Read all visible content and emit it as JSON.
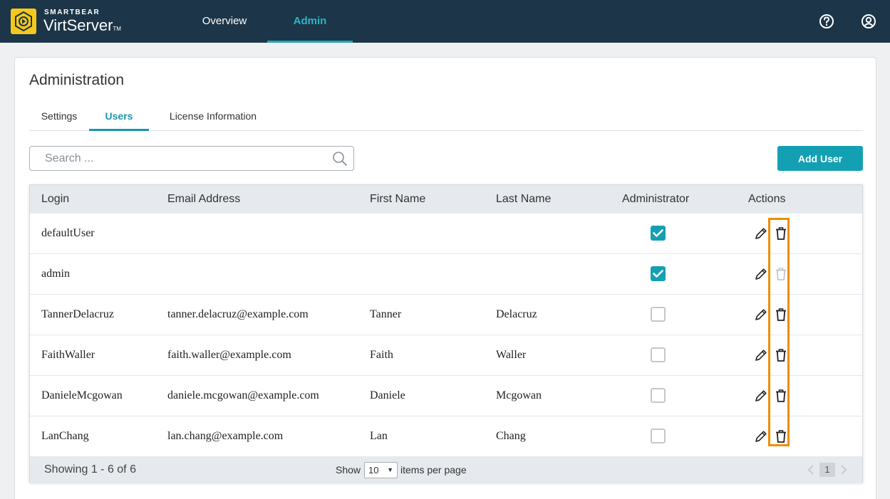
{
  "header": {
    "brand_small": "SMARTBEAR",
    "brand_name": "VirtServer",
    "brand_tm": "TM",
    "nav": [
      {
        "label": "Overview",
        "active": false
      },
      {
        "label": "Admin",
        "active": true
      }
    ],
    "icons": [
      "help-icon",
      "user-account-icon"
    ]
  },
  "page": {
    "title": "Administration",
    "tabs": [
      {
        "label": "Settings",
        "active": false
      },
      {
        "label": "Users",
        "active": true
      },
      {
        "label": "License Information",
        "active": false
      }
    ],
    "search_placeholder": "Search ...",
    "add_user_label": "Add User"
  },
  "table": {
    "columns": [
      "Login",
      "Email Address",
      "First Name",
      "Last Name",
      "Administrator",
      "Actions"
    ],
    "rows": [
      {
        "login": "defaultUser",
        "email": "",
        "first": "",
        "last": "",
        "admin": true,
        "delete_enabled": true
      },
      {
        "login": "admin",
        "email": "",
        "first": "",
        "last": "",
        "admin": true,
        "delete_enabled": false
      },
      {
        "login": "TannerDelacruz",
        "email": "tanner.delacruz@example.com",
        "first": "Tanner",
        "last": "Delacruz",
        "admin": false,
        "delete_enabled": true
      },
      {
        "login": "FaithWaller",
        "email": "faith.waller@example.com",
        "first": "Faith",
        "last": "Waller",
        "admin": false,
        "delete_enabled": true
      },
      {
        "login": "DanieleMcgowan",
        "email": "daniele.mcgowan@example.com",
        "first": "Daniele",
        "last": "Mcgowan",
        "admin": false,
        "delete_enabled": true
      },
      {
        "login": "LanChang",
        "email": "lan.chang@example.com",
        "first": "Lan",
        "last": "Chang",
        "admin": false,
        "delete_enabled": true
      }
    ]
  },
  "footer": {
    "showing": "Showing 1 - 6 of 6",
    "show_label": "Show",
    "page_size": "10",
    "per_page_label": "items per page",
    "current_page": "1"
  },
  "colors": {
    "topbar": "#1c3548",
    "accent": "#14a0b3",
    "highlight": "#f08c00",
    "logo": "#f4c91b"
  }
}
